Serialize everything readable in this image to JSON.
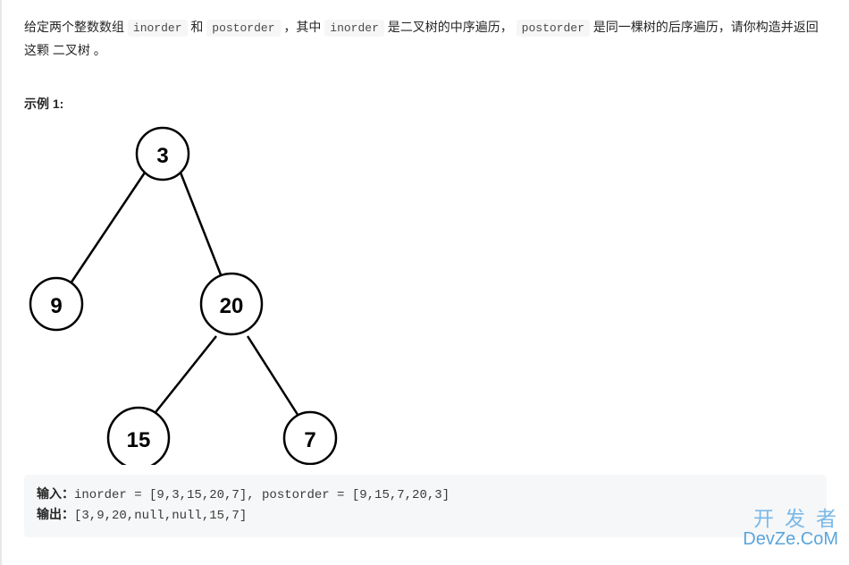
{
  "description": {
    "part1": "给定两个整数数组 ",
    "code1": "inorder",
    "part2": " 和 ",
    "code2": "postorder",
    "part3": " ，其中 ",
    "code3": "inorder",
    "part4": " 是二叉树的中序遍历， ",
    "code4": "postorder",
    "part5": " 是同一棵树的后序遍历，请你构造并返回这颗 二叉树 。"
  },
  "example": {
    "title": "示例 1:",
    "input_label": "输入：",
    "input_value": "inorder = [9,3,15,20,7], postorder = [9,15,7,20,3]",
    "output_label": "输出：",
    "output_value": "[3,9,20,null,null,15,7]"
  },
  "tree": {
    "nodes": {
      "root": "3",
      "left": "9",
      "right": "20",
      "right_left": "15",
      "right_right": "7"
    }
  },
  "watermark": {
    "line1": "开发者",
    "line2_a": "DevZe",
    "line2_b": ".CoM"
  }
}
